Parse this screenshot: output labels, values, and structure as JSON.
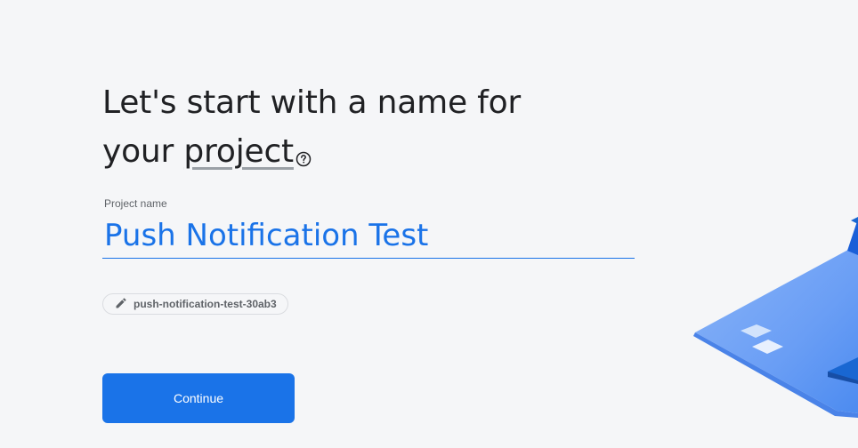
{
  "heading": {
    "line1": "Let's start with a name for",
    "line2_prefix": "your ",
    "line2_link": "project"
  },
  "project_name": {
    "label": "Project name",
    "value": "Push Notification Test"
  },
  "project_id_chip": {
    "text": "push-notification-test-30ab3"
  },
  "continue_button": {
    "label": "Continue"
  },
  "colors": {
    "accent": "#1a73e8",
    "background": "#f5f6f8",
    "text": "#202124",
    "muted": "#5f6368"
  },
  "icons": {
    "help": "help-circle-icon",
    "edit": "pencil-icon"
  }
}
